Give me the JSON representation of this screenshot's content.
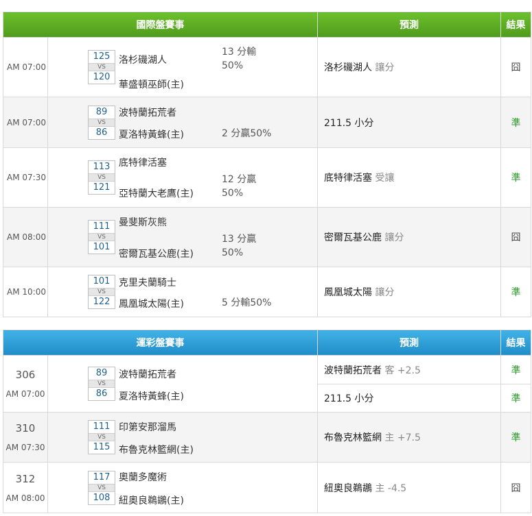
{
  "section1": {
    "header": {
      "title": "國際盤賽事",
      "prediction": "預測",
      "result": "結果"
    },
    "games": [
      {
        "time": "AM 07:00",
        "away": {
          "team": "洛杉磯湖人",
          "score": "125"
        },
        "home": {
          "team": "華盛頓巫師(主)",
          "score": "120"
        },
        "vs": "VS",
        "odds_line1": "13 分輸",
        "odds_line2": "50%",
        "pred_main": "洛杉磯湖人",
        "pred_tag": "讓分",
        "result": "囧"
      },
      {
        "time": "AM 07:00",
        "away": {
          "team": "波特蘭拓荒者",
          "score": "89"
        },
        "home": {
          "team": "夏洛特黃蜂(主)",
          "score": "86"
        },
        "vs": "VS",
        "odds_line1": "2 分贏50%",
        "odds_line2": "",
        "pred_main": "211.5 小分",
        "pred_tag": "",
        "result": "準"
      },
      {
        "time": "AM 07:30",
        "away": {
          "team": "底特律活塞",
          "score": "113"
        },
        "home": {
          "team": "亞特蘭大老鷹(主)",
          "score": "121"
        },
        "vs": "VS",
        "odds_line1": "12 分贏",
        "odds_line2": "50%",
        "pred_main": "底特律活塞",
        "pred_tag": "受讓",
        "result": "準"
      },
      {
        "time": "AM 08:00",
        "away": {
          "team": "曼斐斯灰熊",
          "score": "111"
        },
        "home": {
          "team": "密爾瓦基公鹿(主)",
          "score": "101"
        },
        "vs": "VS",
        "odds_line1": "13 分贏",
        "odds_line2": "50%",
        "pred_main": "密爾瓦基公鹿",
        "pred_tag": "讓分",
        "result": "囧"
      },
      {
        "time": "AM 10:00",
        "away": {
          "team": "克里夫蘭騎士",
          "score": "101"
        },
        "home": {
          "team": "鳳凰城太陽(主)",
          "score": "122"
        },
        "vs": "VS",
        "odds_line1": "5 分輸50%",
        "odds_line2": "",
        "pred_main": "鳳凰城太陽",
        "pred_tag": "讓分",
        "result": "準"
      }
    ]
  },
  "section2": {
    "header": {
      "title": "運彩盤賽事",
      "prediction": "預測",
      "result": "結果"
    },
    "games": [
      {
        "code": "306",
        "time": "AM 07:00",
        "away": {
          "team": "波特蘭拓荒者",
          "score": "89"
        },
        "home": {
          "team": "夏洛特黃蜂(主)",
          "score": "86"
        },
        "vs": "VS",
        "preds": [
          {
            "main": "波特蘭拓荒者",
            "tag": "客 +2.5",
            "result": "準"
          },
          {
            "main": "211.5 小分",
            "tag": "",
            "result": "準"
          }
        ]
      },
      {
        "code": "310",
        "time": "AM 07:30",
        "away": {
          "team": "印第安那溜馬",
          "score": "111"
        },
        "home": {
          "team": "布魯克林籃網(主)",
          "score": "115"
        },
        "vs": "VS",
        "preds": [
          {
            "main": "布魯克林籃網",
            "tag": "主 +7.5",
            "result": "準"
          }
        ]
      },
      {
        "code": "312",
        "time": "AM 08:00",
        "away": {
          "team": "奧蘭多魔術",
          "score": "117"
        },
        "home": {
          "team": "紐奧良鵜鶘(主)",
          "score": "108"
        },
        "vs": "VS",
        "preds": [
          {
            "main": "紐奧良鵜鶘",
            "tag": "主 -4.5",
            "result": "囧"
          }
        ]
      }
    ]
  },
  "colors": {
    "section1_header": "#5fae24",
    "section2_header": "#2e9fd6",
    "hit": "#2a9b2a",
    "score": "#1f5f8b"
  }
}
